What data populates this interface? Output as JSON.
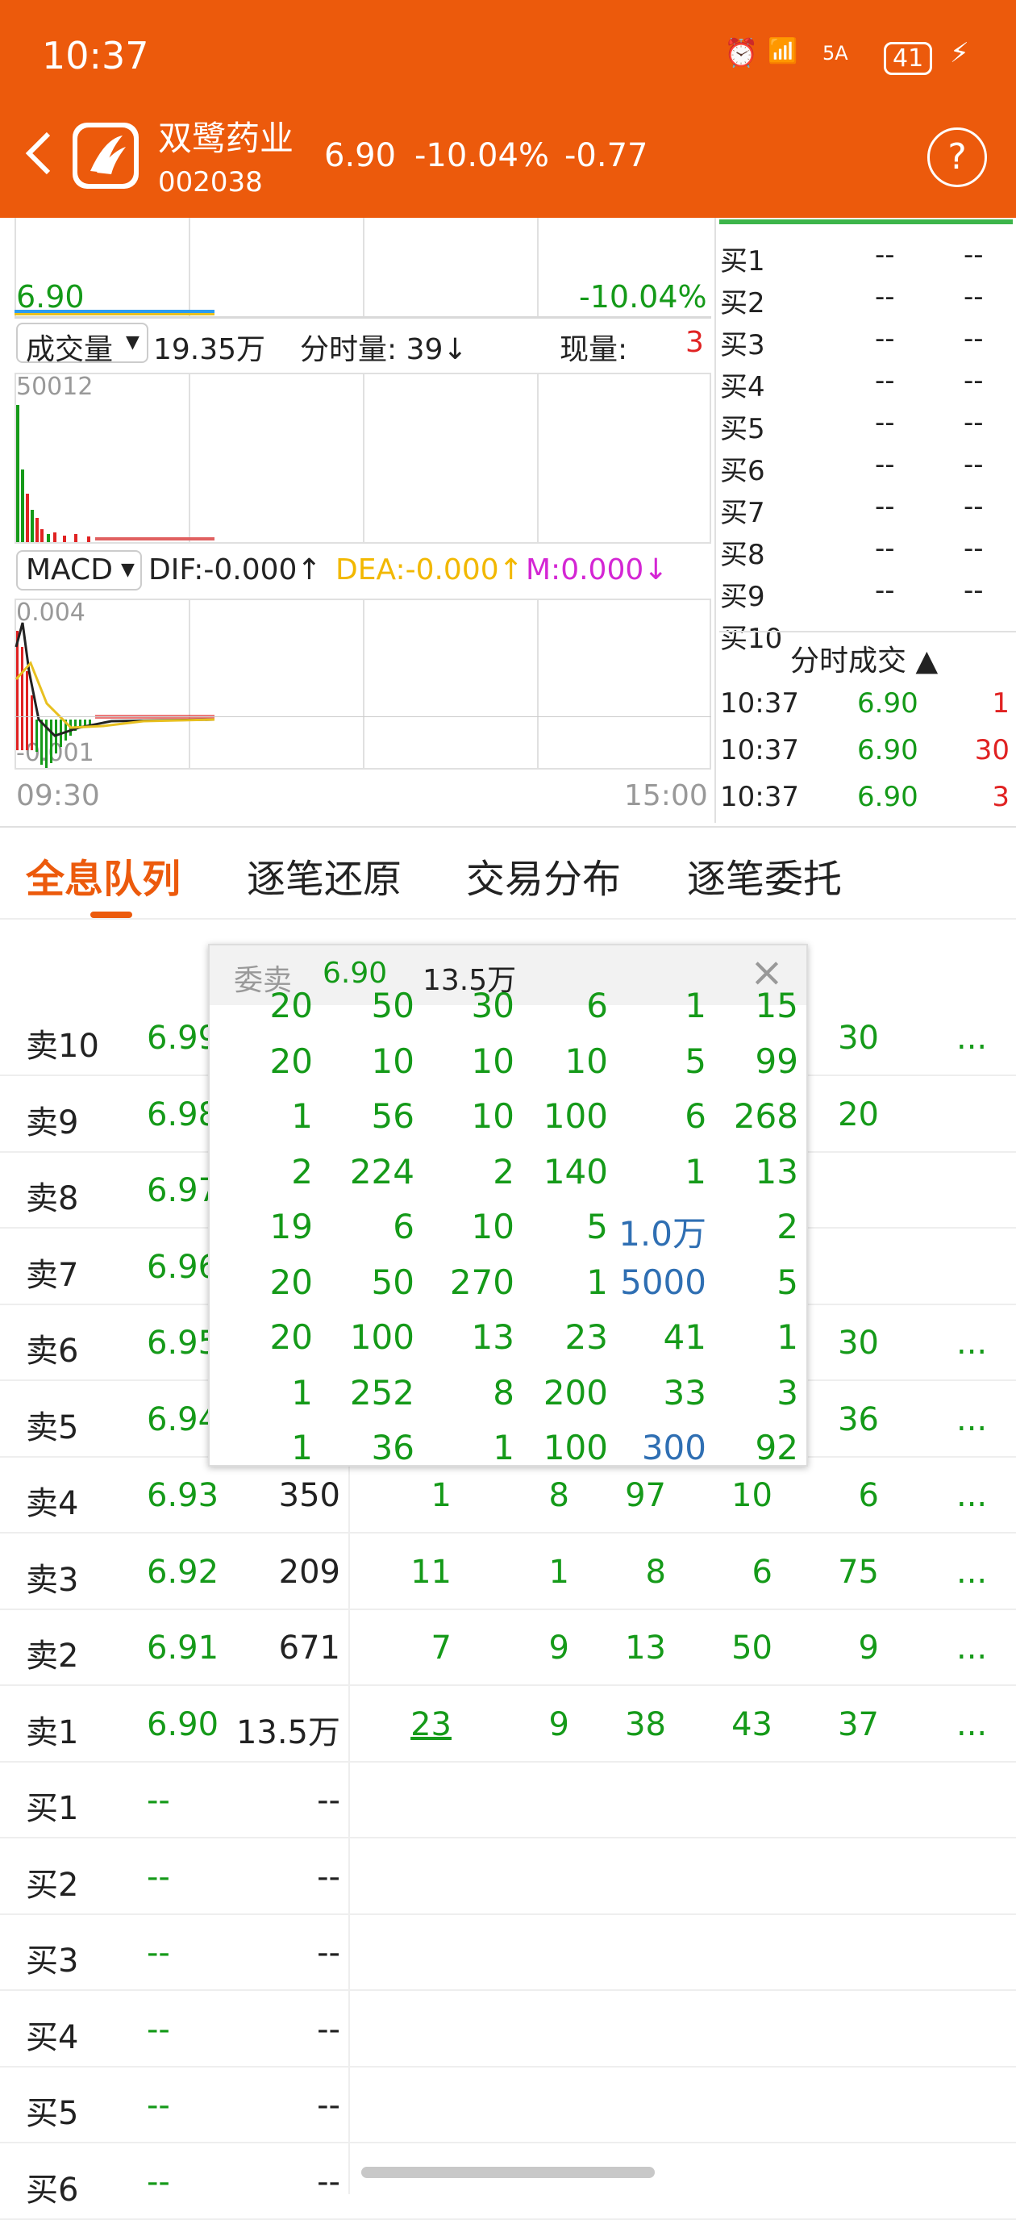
{
  "status": {
    "time": "10:37",
    "network": "5A",
    "battery": "41"
  },
  "stock": {
    "name": "双鹭药业",
    "code": "002038",
    "price": "6.90",
    "change_pct": "-10.04%",
    "change": "-0.77"
  },
  "header": {
    "help_label": "?"
  },
  "chart": {
    "price_label": "6.90",
    "pct_label": "-10.04%",
    "volume_selector": "成交量",
    "volume_total": "19.35万",
    "tick_vol_label": "分时量: 39↓",
    "cur_vol_label": "现量:",
    "cur_vol_value": "3",
    "vol_axis_max": "50012",
    "macd_selector": "MACD",
    "dif": "DIF:-0.000↑",
    "dea": "DEA:-0.000↑",
    "m": "M:0.000↓",
    "macd_max": "0.004",
    "macd_min": "-0.001",
    "time_start": "09:30",
    "time_end": "15:00"
  },
  "orderbook": {
    "buy": [
      {
        "label": "买1",
        "price": "--",
        "vol": "--"
      },
      {
        "label": "买2",
        "price": "--",
        "vol": "--"
      },
      {
        "label": "买3",
        "price": "--",
        "vol": "--"
      },
      {
        "label": "买4",
        "price": "--",
        "vol": "--"
      },
      {
        "label": "买5",
        "price": "--",
        "vol": "--"
      },
      {
        "label": "买6",
        "price": "--",
        "vol": "--"
      },
      {
        "label": "买7",
        "price": "--",
        "vol": "--"
      },
      {
        "label": "买8",
        "price": "--",
        "vol": "--"
      },
      {
        "label": "买9",
        "price": "--",
        "vol": "--"
      },
      {
        "label": "买10",
        "price": "",
        "vol": ""
      }
    ]
  },
  "ticks": {
    "title": "分时成交 ▲",
    "rows": [
      {
        "time": "10:37",
        "price": "6.90",
        "vol": "1"
      },
      {
        "time": "10:37",
        "price": "6.90",
        "vol": "30"
      },
      {
        "time": "10:37",
        "price": "6.90",
        "vol": "3"
      }
    ]
  },
  "tabs": [
    "全息队列",
    "逐笔还原",
    "交易分布",
    "逐笔委托"
  ],
  "queue": [
    {
      "label": "卖10",
      "price": "6.99",
      "vol": "",
      "q": [
        "",
        "",
        "",
        "",
        "30"
      ],
      "more": "..."
    },
    {
      "label": "卖9",
      "price": "6.98",
      "vol": "",
      "q": [
        "",
        "",
        "",
        "",
        "20"
      ],
      "more": ""
    },
    {
      "label": "卖8",
      "price": "6.97",
      "vol": "",
      "q": [
        "",
        "",
        "",
        "",
        ""
      ],
      "more": ""
    },
    {
      "label": "卖7",
      "price": "6.96",
      "vol": "",
      "q": [
        "",
        "",
        "",
        "",
        ""
      ],
      "more": ""
    },
    {
      "label": "卖6",
      "price": "6.95",
      "vol": "",
      "q": [
        "",
        "",
        "",
        "",
        "30"
      ],
      "more": "..."
    },
    {
      "label": "卖5",
      "price": "6.94",
      "vol": "",
      "q": [
        "",
        "",
        "",
        "",
        "36"
      ],
      "more": "..."
    },
    {
      "label": "卖4",
      "price": "6.93",
      "vol": "350",
      "q": [
        "1",
        "8",
        "97",
        "10",
        "6"
      ],
      "more": "..."
    },
    {
      "label": "卖3",
      "price": "6.92",
      "vol": "209",
      "q": [
        "11",
        "1",
        "8",
        "6",
        "75"
      ],
      "more": "..."
    },
    {
      "label": "卖2",
      "price": "6.91",
      "vol": "671",
      "q": [
        "7",
        "9",
        "13",
        "50",
        "9"
      ],
      "more": "..."
    },
    {
      "label": "卖1",
      "price": "6.90",
      "vol": "13.5万",
      "q": [
        "23",
        "9",
        "38",
        "43",
        "37"
      ],
      "more": "..."
    },
    {
      "label": "买1",
      "price": "--",
      "vol": "--",
      "q": [
        "",
        "",
        "",
        "",
        ""
      ],
      "more": ""
    },
    {
      "label": "买2",
      "price": "--",
      "vol": "--",
      "q": [
        "",
        "",
        "",
        "",
        ""
      ],
      "more": ""
    },
    {
      "label": "买3",
      "price": "--",
      "vol": "--",
      "q": [
        "",
        "",
        "",
        "",
        ""
      ],
      "more": ""
    },
    {
      "label": "买4",
      "price": "--",
      "vol": "--",
      "q": [
        "",
        "",
        "",
        "",
        ""
      ],
      "more": ""
    },
    {
      "label": "买5",
      "price": "--",
      "vol": "--",
      "q": [
        "",
        "",
        "",
        "",
        ""
      ],
      "more": ""
    },
    {
      "label": "买6",
      "price": "--",
      "vol": "--",
      "q": [
        "",
        "",
        "",
        "",
        ""
      ],
      "more": ""
    }
  ],
  "popup": {
    "title": "委卖",
    "price": "6.90",
    "total": "13.5万",
    "close": "×",
    "rows": [
      [
        "20",
        "50",
        "30",
        "6",
        "1",
        "15"
      ],
      [
        "20",
        "10",
        "10",
        "10",
        "5",
        "99"
      ],
      [
        "1",
        "56",
        "10",
        "100",
        "6",
        "268"
      ],
      [
        "2",
        "224",
        "2",
        "140",
        "1",
        "13"
      ],
      [
        "19",
        "6",
        "10",
        "5",
        "1.0万",
        "2"
      ],
      [
        "20",
        "50",
        "270",
        "1",
        "5000",
        "5"
      ],
      [
        "20",
        "100",
        "13",
        "23",
        "41",
        "1"
      ],
      [
        "1",
        "252",
        "8",
        "200",
        "33",
        "3"
      ],
      [
        "1",
        "36",
        "1",
        "100",
        "300",
        "92"
      ]
    ]
  },
  "colors": {
    "brand": "#ec5a0c",
    "up": "#e02222",
    "down": "#159a19",
    "highlight": "#2f6fb3"
  }
}
